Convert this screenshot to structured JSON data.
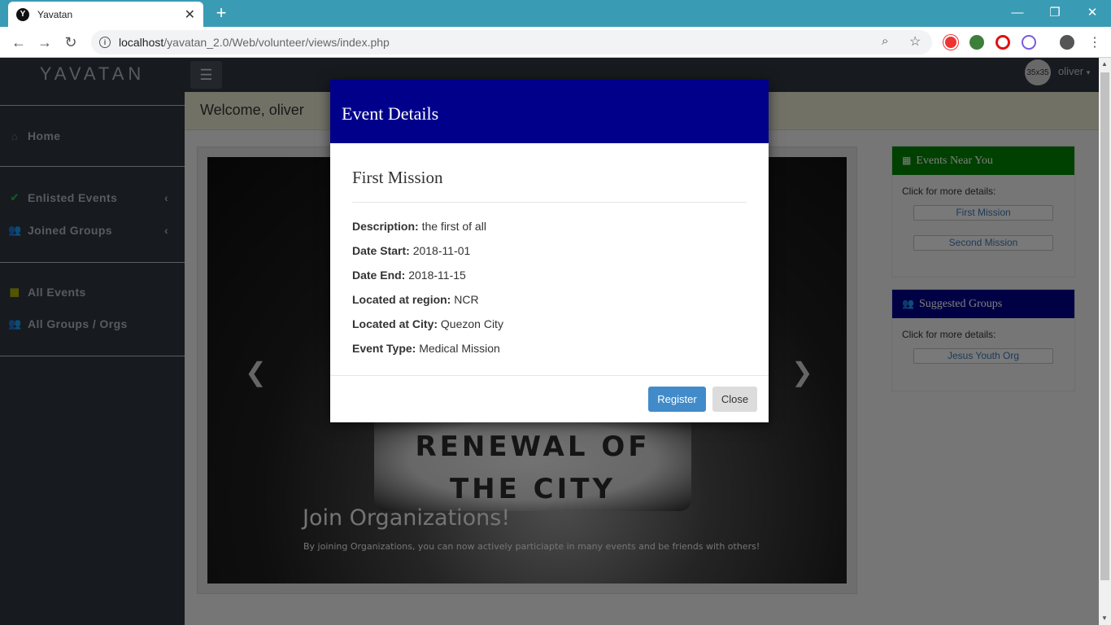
{
  "browser": {
    "tab_title": "Yavatan",
    "tab_favicon": "Y",
    "url_host": "localhost",
    "url_path": "/yavatan_2.0/Web/volunteer/views/index.php"
  },
  "app": {
    "logo": "YAVATAN",
    "user": {
      "avatar_label": "35x35",
      "name": "oliver"
    },
    "welcome": "Welcome, oliver"
  },
  "sidebar": {
    "items": [
      {
        "label": "Home",
        "icon": "home-icon",
        "color": "#5a8a8f"
      },
      {
        "label": "Enlisted Events",
        "icon": "check-icon",
        "color": "#28a745"
      },
      {
        "label": "Joined Groups",
        "icon": "users-icon",
        "color": "#d4a017"
      },
      {
        "label": "All Events",
        "icon": "calendar-icon",
        "color": "#b5b500"
      },
      {
        "label": "All Groups / Orgs",
        "icon": "users-icon",
        "color": "#b05fa8"
      }
    ]
  },
  "carousel": {
    "sign_line1": "RENEWAL OF",
    "sign_line2": "THE CITY",
    "caption_title": "Join Organizations!",
    "caption_text": "By joining Organizations, you can now actively particiapte in many events and be friends with others!"
  },
  "panels": {
    "events_near": {
      "title": "Events Near You",
      "color": "#008000",
      "hint": "Click for more details:",
      "items": [
        "First Mission",
        "Second Mission"
      ]
    },
    "suggested_groups": {
      "title": "Suggested Groups",
      "color": "#00008b",
      "hint": "Click for more details:",
      "items": [
        "Jesus Youth Org"
      ]
    }
  },
  "modal": {
    "title": "Event Details",
    "header_color": "#00008b",
    "event_name": "First Mission",
    "details": [
      {
        "label": "Description:",
        "value": "the first of all"
      },
      {
        "label": "Date Start:",
        "value": "2018-11-01"
      },
      {
        "label": "Date End:",
        "value": "2018-11-15"
      },
      {
        "label": "Located at region:",
        "value": "NCR"
      },
      {
        "label": "Located at City:",
        "value": "Quezon City"
      },
      {
        "label": "Event Type:",
        "value": "Medical Mission"
      }
    ],
    "register_label": "Register",
    "close_label": "Close"
  }
}
